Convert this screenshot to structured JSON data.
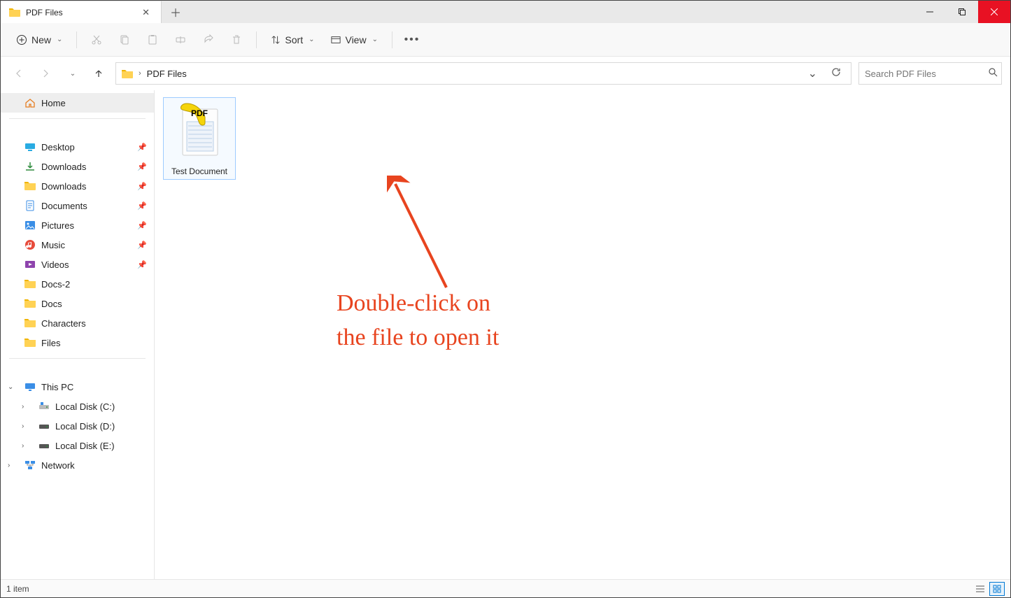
{
  "tab": {
    "title": "PDF Files"
  },
  "toolbar": {
    "new_label": "New",
    "sort_label": "Sort",
    "view_label": "View"
  },
  "breadcrumb": {
    "path": "PDF Files"
  },
  "search": {
    "placeholder": "Search PDF Files"
  },
  "sidebar": {
    "home_label": "Home",
    "quick": [
      {
        "label": "Desktop",
        "icon": "desktop",
        "pinned": true
      },
      {
        "label": "Downloads",
        "icon": "downloads",
        "pinned": true
      },
      {
        "label": "Downloads",
        "icon": "folder",
        "pinned": true
      },
      {
        "label": "Documents",
        "icon": "documents",
        "pinned": true
      },
      {
        "label": "Pictures",
        "icon": "pictures",
        "pinned": true
      },
      {
        "label": "Music",
        "icon": "music",
        "pinned": true
      },
      {
        "label": "Videos",
        "icon": "videos",
        "pinned": true
      },
      {
        "label": "Docs-2",
        "icon": "folder",
        "pinned": false
      },
      {
        "label": "Docs",
        "icon": "folder",
        "pinned": false
      },
      {
        "label": "Characters",
        "icon": "folder",
        "pinned": false
      },
      {
        "label": "Files",
        "icon": "folder",
        "pinned": false
      }
    ],
    "this_pc_label": "This PC",
    "drives": [
      {
        "label": "Local Disk (C:)"
      },
      {
        "label": "Local Disk (D:)"
      },
      {
        "label": "Local Disk (E:)"
      }
    ],
    "network_label": "Network"
  },
  "files": [
    {
      "name": "Test Document"
    }
  ],
  "annotation": {
    "text": "Double-click on\nthe file to open it"
  },
  "status": {
    "count": "1 item"
  }
}
